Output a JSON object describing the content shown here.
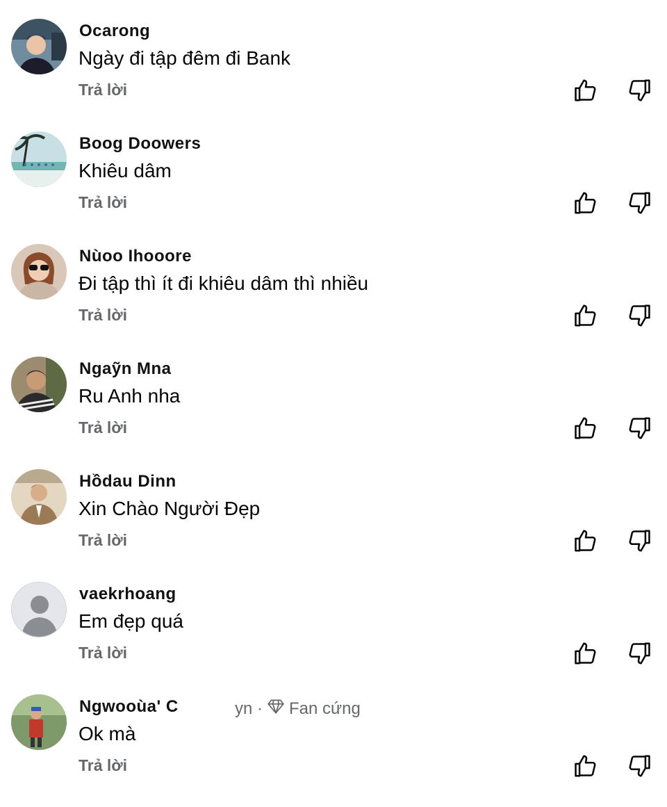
{
  "comments": [
    {
      "name": "Ocarong",
      "text": "Ngày đi tập đêm đi Bank",
      "reply": "Trả lời"
    },
    {
      "name": "Boog Doowers",
      "text": "Khiêu dâm",
      "reply": "Trả lời"
    },
    {
      "name": "Nùoo Ihooore",
      "text": "Đi tập thì ít đi khiêu dâm thì nhiều",
      "reply": "Trả lời"
    },
    {
      "name": "Ngaỹn Mna",
      "text": "Ru Anh nha",
      "reply": "Trả lời"
    },
    {
      "name": "Hồdau Dinn",
      "text": "Xin Chào Người Đẹp",
      "reply": "Trả lời"
    },
    {
      "name": "vaekrhoang",
      "text": "Em đẹp quá",
      "reply": "Trả lời"
    },
    {
      "name": "Ngwooùa' C",
      "text": "Ok mà",
      "reply": "Trả lời",
      "badge": "Fan cứng",
      "badge_prefix": "yn ·",
      "badge_icon": "diamond-icon"
    }
  ],
  "icons": {
    "like": "thumbs-up-icon",
    "dislike": "thumbs-down-icon"
  },
  "colors": {
    "secondary_text": "#65676b",
    "primary_text": "#050505"
  }
}
